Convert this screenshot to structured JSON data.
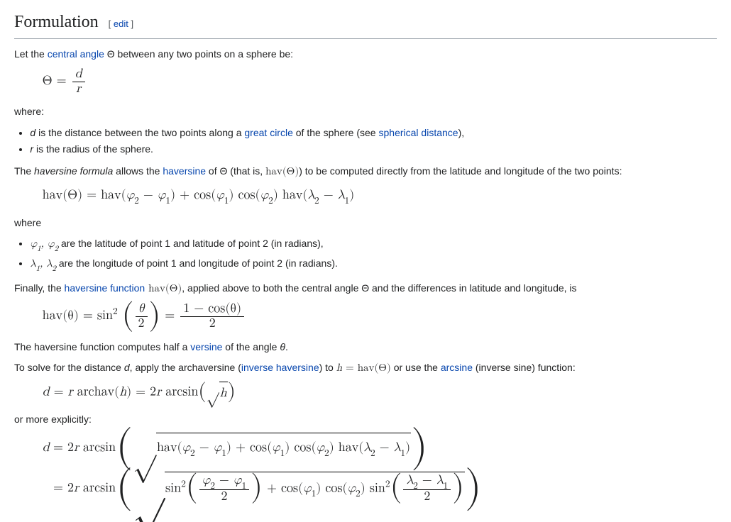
{
  "heading": {
    "title": "Formulation",
    "edit_label": "edit"
  },
  "intro": {
    "prefix": "Let the ",
    "link_central_angle": "central angle",
    "after_link": " Θ between any two points on a sphere be:"
  },
  "eq1": {
    "lhs": "Θ =",
    "num": "d",
    "den": "r"
  },
  "where_label": "where:",
  "where_list": {
    "item1": {
      "var": "d",
      "mid": " is the distance between the two points along a ",
      "link1": "great circle",
      "after1": " of the sphere (see ",
      "link2": "spherical distance",
      "after2": "),"
    },
    "item2": {
      "var": "r",
      "rest": " is the radius of the sphere."
    }
  },
  "para2": {
    "pre": "The ",
    "hf_italic": "haversine formula",
    "mid1": " allows the ",
    "link_hav": "haversine",
    "mid2": " of Θ (that is, ",
    "havtheta": "hav(Θ)",
    "mid3": ") to be computed directly from the latitude and longitude of the two points:"
  },
  "eq2": "hav(Θ) = hav(φ₂ − φ₁) + cos(φ₁) cos(φ₂) hav(λ₂ − λ₁)",
  "where2_label": "where",
  "where2_list": {
    "item1": {
      "vars": "φ₁, φ₂",
      "rest": " are the latitude of point 1 and latitude of point 2 (in radians),"
    },
    "item2": {
      "vars": "λ₁, λ₂",
      "rest": " are the longitude of point 1 and longitude of point 2 (in radians)."
    }
  },
  "para3": {
    "pre": "Finally, the ",
    "link": "haversine function",
    "havtheta": " hav(Θ)",
    "rest": ", applied above to both the central angle Θ and the differences in latitude and longitude, is"
  },
  "eq3": {
    "lhs": "hav(θ) = sin",
    "pow": "2",
    "frac1_num": "θ",
    "frac1_den": "2",
    "eq": " = ",
    "frac2_num": "1 − cos(θ)",
    "frac2_den": "2"
  },
  "para4": {
    "pre": "The haversine function computes half a ",
    "link": "versine",
    "post": " of the angle ",
    "theta": "θ",
    "dot": "."
  },
  "para5": {
    "pre": "To solve for the distance ",
    "d": "d",
    "mid1": ", apply the archaversine (",
    "link1": "inverse haversine",
    "mid2": ") to ",
    "heq": "h = hav(Θ)",
    "mid3": " or use the ",
    "link2": "arcsine",
    "post": " (inverse sine) function:"
  },
  "eq4": {
    "lhs": "d = r archav(h) = 2r arcsin",
    "sqrt_arg": "h",
    "close": ""
  },
  "para6": "or more explicitly:",
  "eq5": {
    "line1_lhs": "d",
    "line1_pre": "= 2r arcsin",
    "line1_sqrt": "hav(φ₂ − φ₁) + cos(φ₁) cos(φ₂) hav(λ₂ − λ₁)",
    "line2_pre": "= 2r arcsin",
    "line2_sin2a": "sin",
    "line2_frac1_num": "φ₂ − φ₁",
    "line2_frac1_den": "2",
    "line2_mid": " + cos(φ₁) cos(φ₂) sin",
    "line2_frac2_num": "λ₂ − λ₁",
    "line2_frac2_den": "2"
  }
}
